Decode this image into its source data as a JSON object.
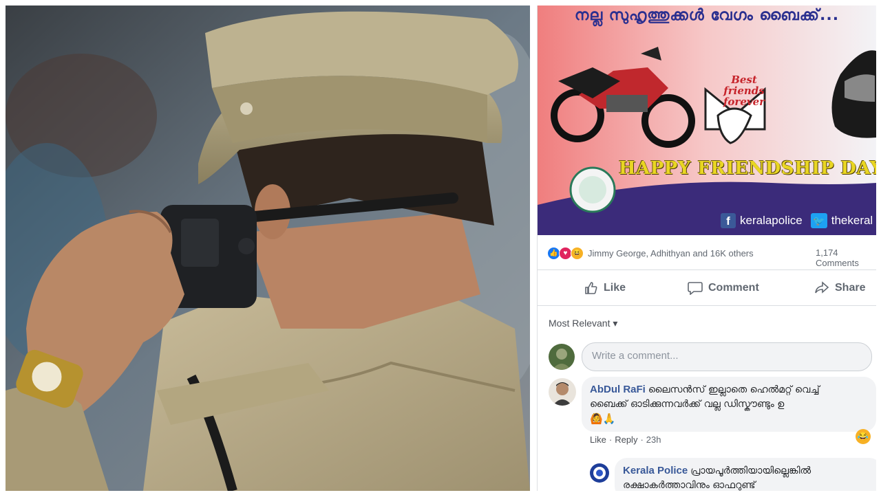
{
  "banner": {
    "title": "നല്ല സുഹൃത്തുക്കൾ വേഗം ബൈക്ക്...",
    "best_friends": "Best friends forever",
    "happy": "HAPPY FRIENDSHIP DAY",
    "facebook_handle": "keralapolice",
    "twitter_handle": "thekeral"
  },
  "reactions": {
    "names": "Jimmy George, Adhithyan and 16K others",
    "comments_count": "1,174 Comments"
  },
  "actions": {
    "like": "Like",
    "comment": "Comment",
    "share": "Share"
  },
  "filter": {
    "label": "Most Relevant ▾"
  },
  "write_comment": {
    "placeholder": "Write a comment..."
  },
  "comments": [
    {
      "author": "AbDul RaFi",
      "line1": "ലൈസൻസ് ഇല്ലാതെ ഹെൽമറ്റ് വെച്ച്",
      "line2": "ബൈക്ക് ഓടിക്കുന്നവർക്ക് വല്ല ഡിസ്കൗണ്ടും ഉ",
      "emoji": "🙆🙏",
      "like": "Like",
      "reply": "Reply",
      "time": "23h"
    },
    {
      "author": "Kerala Police",
      "line1": "പ്രായപൂർത്തിയായില്ലെങ്കിൽ",
      "line2": "രക്ഷാകർത്താവിനും ഓഫറുണ്ട്"
    }
  ],
  "colors": {
    "fb_link": "#385898",
    "like_blue": "#1877f2",
    "banner_purple": "#3b2b7a"
  }
}
